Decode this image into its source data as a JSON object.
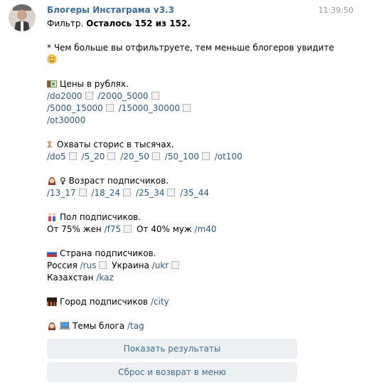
{
  "header": {
    "bot_name": "Блогеры Инстаграма v3.3",
    "time": "11:39:50"
  },
  "message": {
    "filter_prefix": "Фильтр.",
    "filter_status": "Осталось 152 из 152.",
    "note": "* Чем больше вы отфильтруете, тем меньше блогеров увидите",
    "price": {
      "title": "Цены в рублях.",
      "row1": [
        "/do2000",
        "/2000_5000"
      ],
      "row2": [
        "/5000_15000",
        "/15000_30000"
      ],
      "row3": [
        "/ot30000"
      ]
    },
    "reach": {
      "title": "Охваты сторис в тысячах.",
      "items": [
        "/do5",
        "/5_20",
        "/20_50",
        "/50_100",
        "/ot100"
      ]
    },
    "age": {
      "title": "♀ Возраст подписчиков.",
      "items": [
        "/13_17",
        "/18_24",
        "/25_34",
        "/35_44"
      ]
    },
    "gender": {
      "title": "Пол подписчиков.",
      "women_text": "От 75% жен",
      "women_cmd": "/f75",
      "men_text": "От 40% муж",
      "men_cmd": "/m40"
    },
    "country": {
      "title": "Страна подписчиков.",
      "russia": "Россия",
      "russia_cmd": "/rus",
      "ukraine": "Украина",
      "ukraine_cmd": "/ukr",
      "kazakhstan": "Казахстан",
      "kazakhstan_cmd": "/kaz"
    },
    "city": {
      "text": "Город подписчиков",
      "cmd": "/city"
    },
    "topics": {
      "text": "Темы блога",
      "cmd": "/tag"
    }
  },
  "keyboard": {
    "show_results": "Показать результаты",
    "reset": "Сброс и возврат в меню"
  },
  "colors": {
    "link": "#2b5a85",
    "name": "#3a6d99",
    "button_bg": "#edf1f4"
  },
  "icons": [
    "money-icon",
    "hourglass-icon",
    "woman-icon",
    "couple-icon",
    "russia-flag-icon",
    "city-icon",
    "laptop-icon",
    "wink-emoji-icon"
  ]
}
